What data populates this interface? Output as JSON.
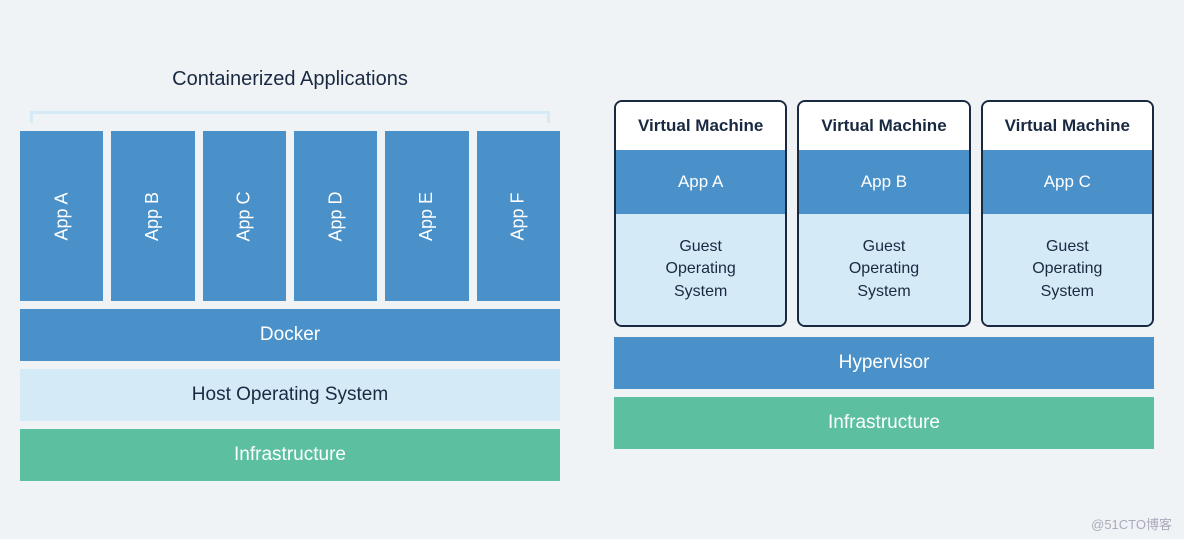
{
  "left": {
    "title": "Containerized Applications",
    "apps": [
      "App A",
      "App B",
      "App C",
      "App D",
      "App E",
      "App F"
    ],
    "layers": {
      "docker": "Docker",
      "host_os": "Host Operating System",
      "infra": "Infrastructure"
    }
  },
  "right": {
    "vms": [
      {
        "title": "Virtual Machine",
        "app": "App A",
        "guest": "Guest\nOperating\nSystem"
      },
      {
        "title": "Virtual Machine",
        "app": "App B",
        "guest": "Guest\nOperating\nSystem"
      },
      {
        "title": "Virtual Machine",
        "app": "App C",
        "guest": "Guest\nOperating\nSystem"
      }
    ],
    "layers": {
      "hypervisor": "Hypervisor",
      "infra": "Infrastructure"
    }
  },
  "watermark": "@51CTO博客"
}
